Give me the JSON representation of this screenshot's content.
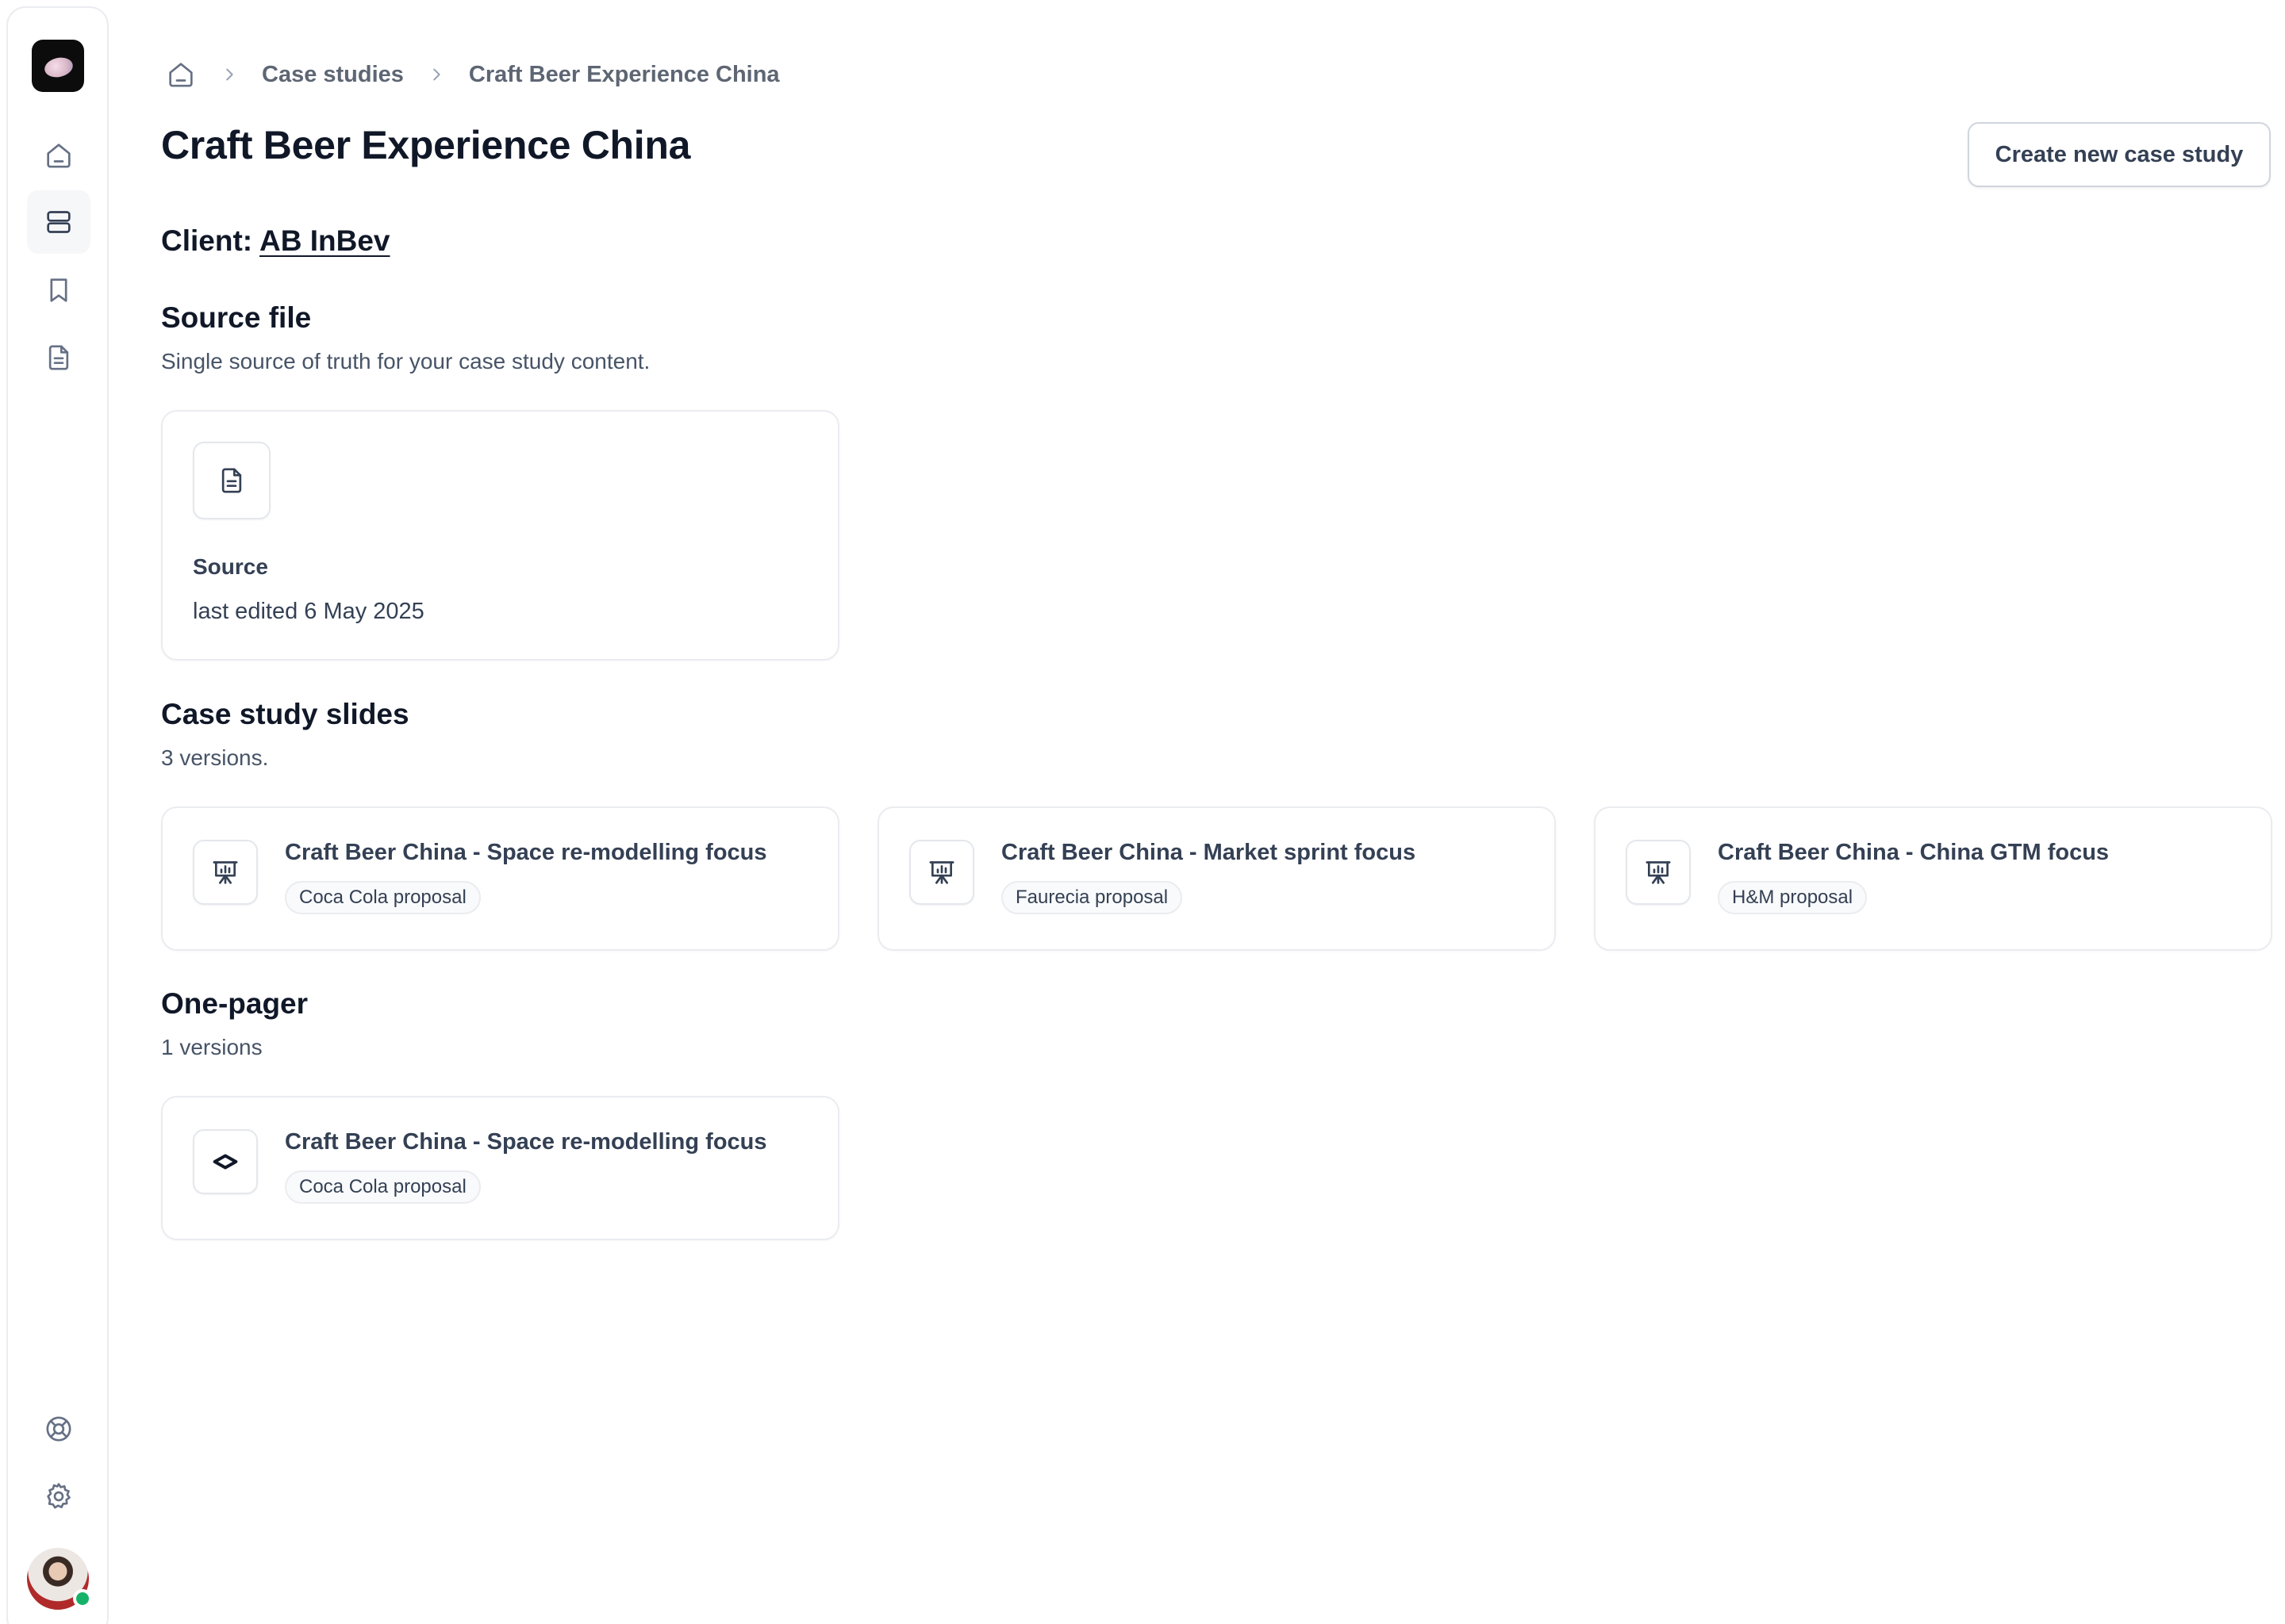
{
  "sidebar": {
    "items": [
      {
        "name": "home-icon"
      },
      {
        "name": "case-studies-icon"
      },
      {
        "name": "bookmark-icon"
      },
      {
        "name": "document-icon"
      }
    ],
    "bottom": [
      {
        "name": "support-icon"
      },
      {
        "name": "settings-icon"
      }
    ]
  },
  "breadcrumb": {
    "items": [
      "Case studies",
      "Craft Beer Experience China"
    ]
  },
  "page": {
    "title": "Craft Beer Experience China",
    "create_button": "Create new case study",
    "client_label": "Client:",
    "client_name": "AB InBev"
  },
  "source_file": {
    "title": "Source file",
    "subtitle": "Single source of truth for your case study content.",
    "card": {
      "name": "Source",
      "edited": "last edited 6 May 2025"
    }
  },
  "slides": {
    "title": "Case study slides",
    "subtitle": "3 versions.",
    "items": [
      {
        "title": "Craft Beer China - Space re-modelling focus",
        "badge": "Coca Cola proposal"
      },
      {
        "title": "Craft Beer China - Market sprint focus",
        "badge": "Faurecia proposal"
      },
      {
        "title": "Craft Beer China - China GTM focus",
        "badge": "H&M proposal"
      }
    ]
  },
  "one_pager": {
    "title": "One-pager",
    "subtitle": "1 versions",
    "items": [
      {
        "title": "Craft Beer China - Space re-modelling focus",
        "badge": "Coca Cola proposal"
      }
    ]
  },
  "colors": {
    "online_status": "#17b26a",
    "border": "#eaecf0",
    "text_primary": "#101828",
    "text_secondary": "#475467"
  }
}
